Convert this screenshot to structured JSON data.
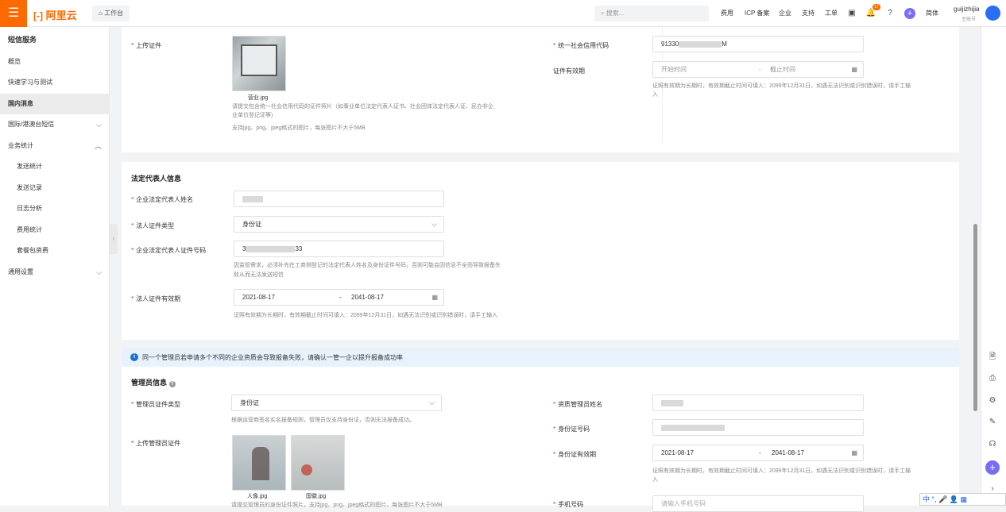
{
  "topbar": {
    "menu_icon": "menu-icon",
    "logo_text": "阿里云",
    "logo_bracket": "[-]",
    "workbench": "工作台",
    "search_placeholder": "搜索...",
    "nav": [
      "费用",
      "ICP 备案",
      "企业",
      "支持",
      "工单"
    ],
    "badge": "17",
    "lang": "简体",
    "user": "guijizhijia",
    "user_sub": "主账号"
  },
  "sidebar": {
    "title": "短信服务",
    "items": [
      "概览",
      "快速学习与测试",
      "国内消息",
      "国际/港澳台短信",
      "业务统计",
      "发送统计",
      "发送记录",
      "日志分析",
      "费用统计",
      "套餐包资费",
      "通用设置"
    ]
  },
  "upload": {
    "label": "上传证件",
    "file": "营业.jpg",
    "hint1": "请提交包含统一社会信用代码的证件照片（如事业单位法定代表人证书、社会团体法定代表人证、民办非企",
    "hint2": "业单位登记证等)",
    "hint3": "支持jpg、png、jpeg格式的图片，每张图片不大于5MB"
  },
  "credit": {
    "label": "统一社会信用代码",
    "value_prefix": "91330",
    "value_suffix": "M",
    "validity_label": "证件有效期",
    "start_placeholder": "开始时间",
    "sep": "-",
    "end_placeholder": "截止时间",
    "hint1": "证照有效期为长期时，有效期截止时间可填入：2099年12月31日，如遇无法识别或识别错误时，请手工输",
    "hint2": "入"
  },
  "legal": {
    "section": "法定代表人信息",
    "name_label": "企业法定代表人姓名",
    "type_label": "法人证件类型",
    "type_value": "身份证",
    "id_label": "企业法定代表人证件号码",
    "id_prefix": "3",
    "id_suffix": "33",
    "id_hint1": "因监管需求，必须补充在工商侧登记的法定代表人姓名及身份证件号码，否则可能会因信息不全而导致报备失",
    "id_hint2": "败从而无法发送短信",
    "validity_label": "法人证件有效期",
    "start": "2021-08-17",
    "sep": "-",
    "end": "2041-08-17",
    "validity_hint": "证照有效期为长期时，有效期截止时间可填入：2099年12月31日，如遇无法识别或识别错误时，请手工输入"
  },
  "notice": {
    "text": "同一个管理员若申请多个不同的企业资质会导致报备失败，请确认一管一企以提升报备成功率"
  },
  "admin": {
    "section": "管理员信息",
    "type_label": "管理员证件类型",
    "type_value": "身份证",
    "type_hint": "根据运营商签名实名报备规则，管理员仅支持身份证，否则无法报备成功。",
    "upload_label": "上传管理员证件",
    "file1": "人像.jpg",
    "file2": "国徽.jpg",
    "upload_hint": "请提交管理员的身份证件照片，支持jpg、png、jpeg格式的图片，每张图片不大于5MB",
    "name_label": "资质管理员姓名",
    "id_label": "身份证号码",
    "validity_label": "身份证有效期",
    "start": "2021-08-17",
    "sep": "-",
    "end": "2041-08-17",
    "validity_hint1": "证照有效期为长期时，有效期截止时间可填入：2099年12月31日，如遇无法识别或识别错误时，请手工输",
    "validity_hint2": "入",
    "phone_label": "手机号码",
    "phone_placeholder": "请输入手机号码"
  },
  "ime": {
    "text": "中 °, 🎤 👤 ▦"
  }
}
